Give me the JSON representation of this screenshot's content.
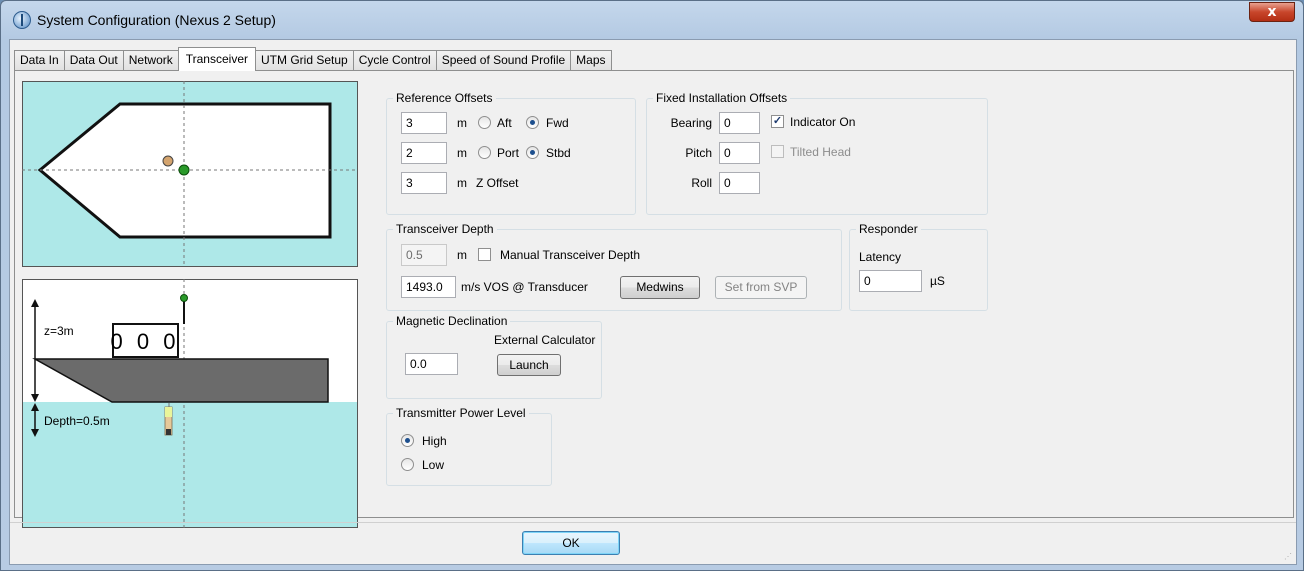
{
  "window": {
    "title": "System Configuration (Nexus 2 Setup)",
    "close_glyph": "x"
  },
  "tabs": [
    "Data In",
    "Data Out",
    "Network",
    "Transceiver",
    "UTM Grid Setup",
    "Cycle Control",
    "Speed of Sound Profile",
    "Maps"
  ],
  "diagram": {
    "z_label": "z=3m",
    "depth_label": "Depth=0.5m",
    "portholes": "0 0 0"
  },
  "reference_offsets": {
    "title": "Reference Offsets",
    "row1": {
      "value": "3",
      "unit": "m",
      "opt_a": "Aft",
      "opt_b": "Fwd"
    },
    "row2": {
      "value": "2",
      "unit": "m",
      "opt_a": "Port",
      "opt_b": "Stbd"
    },
    "row3": {
      "value": "3",
      "unit": "m",
      "label": "Z Offset"
    }
  },
  "fixed_installation": {
    "title": "Fixed Installation Offsets",
    "bearing_label": "Bearing",
    "bearing_value": "0",
    "pitch_label": "Pitch",
    "pitch_value": "0",
    "roll_label": "Roll",
    "roll_value": "0",
    "indicator_on": "Indicator On",
    "tilted_head": "Tilted Head"
  },
  "transceiver_depth": {
    "title": "Transceiver Depth",
    "depth_value": "0.5",
    "depth_unit": "m",
    "manual_label": "Manual Transceiver Depth",
    "vos_value": "1493.0",
    "vos_label": "m/s VOS @ Transducer",
    "medwins_button": "Medwins",
    "set_svp_button": "Set from SVP"
  },
  "responder": {
    "title": "Responder",
    "latency_label": "Latency",
    "latency_value": "0",
    "unit": "µS"
  },
  "magnetic": {
    "title": "Magnetic Declination",
    "value": "0.0",
    "calculator_label": "External Calculator",
    "launch_button": "Launch"
  },
  "power": {
    "title": "Transmitter Power Level",
    "high": "High",
    "low": "Low"
  },
  "ok_button": "OK"
}
